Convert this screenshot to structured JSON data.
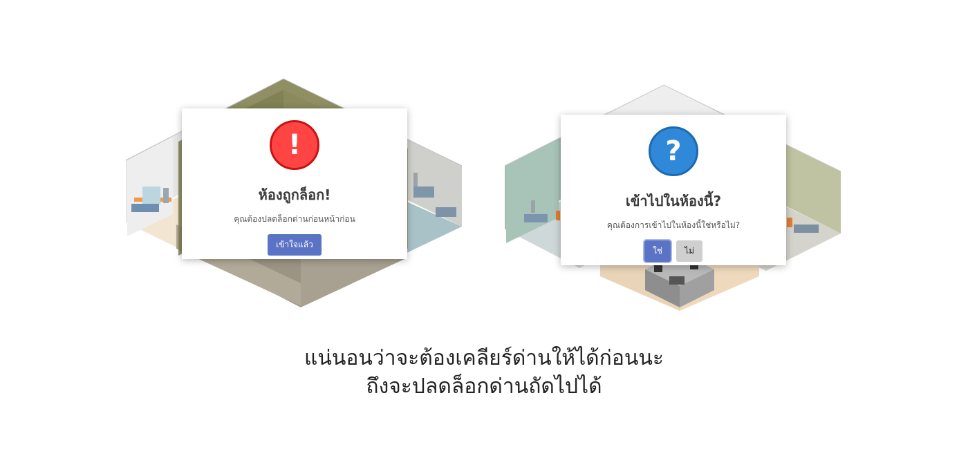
{
  "dialogs": {
    "locked": {
      "icon": "exclamation-icon",
      "icon_glyph": "!",
      "title": "ห้องถูกล็อก!",
      "message": "คุณต้องปลดล็อกด่านก่อนหน้าก่อน",
      "confirm_label": "เข้าใจแล้ว"
    },
    "enter": {
      "icon": "question-icon",
      "icon_glyph": "?",
      "title": "เข้าไปในห้องนี้?",
      "message": "คุณต้องการเข้าไปในห้องนี้ใช่หรือไม่?",
      "yes_label": "ใช่",
      "no_label": "ไม่"
    }
  },
  "caption": {
    "line1": "แน่นอนว่าจะต้องเคลียร์ด่านให้ได้ก่อนนะ",
    "line2": "ถึงจะปลดล็อกด่านถัดไปได้"
  },
  "colors": {
    "error_red": "#ff4444",
    "question_blue": "#2f89d8",
    "button_primary": "#5a73c4",
    "button_secondary": "#cfcfcf"
  }
}
